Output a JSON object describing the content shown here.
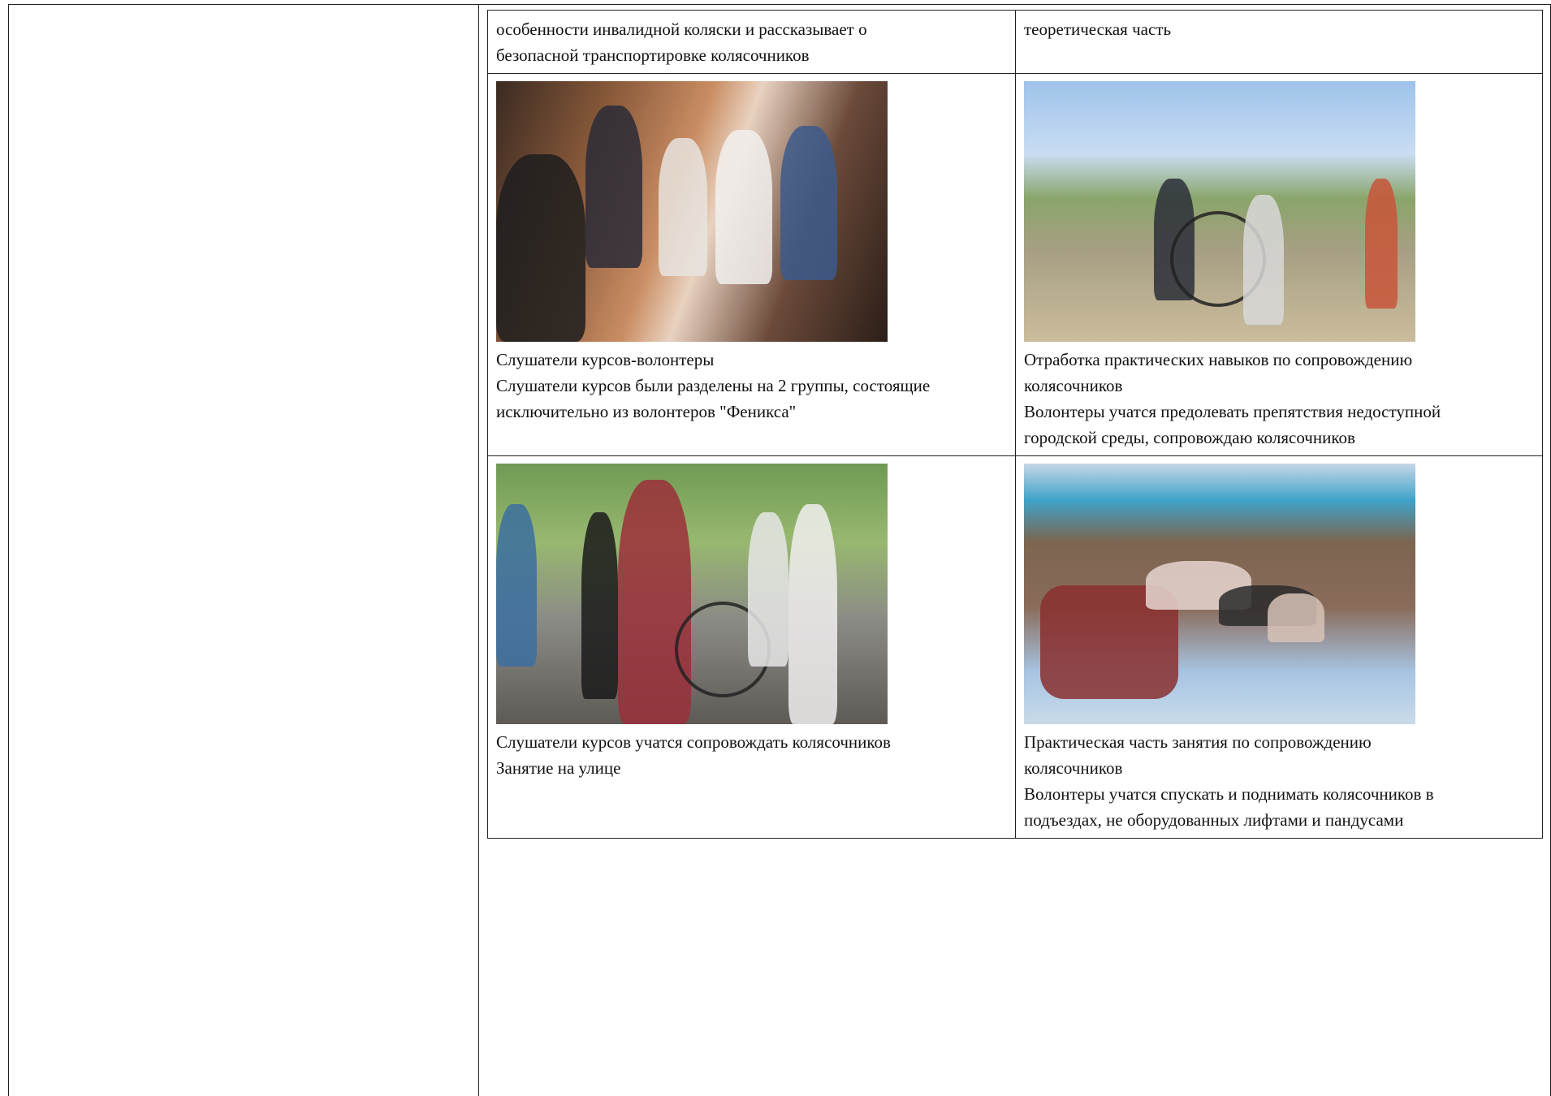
{
  "rows": [
    {
      "left": {
        "lines": [
          "особенности инвалидной коляски и рассказывает о",
          "безопасной транспортировке колясочников"
        ]
      },
      "right": {
        "lines": [
          "теоретическая часть"
        ]
      }
    },
    {
      "left": {
        "photo": "photo-volunteers-indoor",
        "lines": [
          "Слушатели курсов-волонтеры",
          "Слушатели курсов были разделены на 2 группы, состоящие",
          "исключительно из волонтеров \"Феникса\""
        ]
      },
      "right": {
        "photo": "photo-wheelchair-outdoor-practice",
        "lines": [
          "Отработка практических навыков по сопровождению",
          "колясочников",
          "Волонтеры учатся предолевать препятствия недоступной",
          "городской среды, сопровождаю колясочников"
        ]
      }
    },
    {
      "left": {
        "photo": "photo-outdoor-lesson",
        "lines": [
          "Слушатели курсов учатся сопровождать колясочников",
          "Занятие на улице"
        ]
      },
      "right": {
        "photo": "photo-stairwell-practice",
        "lines": [
          "Практическая часть занятия по сопровождению",
          "колясочников",
          "Волонтеры учатся спускать и поднимать колясочников в",
          "подъездах, не оборудованных лифтами и пандусами"
        ]
      }
    }
  ]
}
